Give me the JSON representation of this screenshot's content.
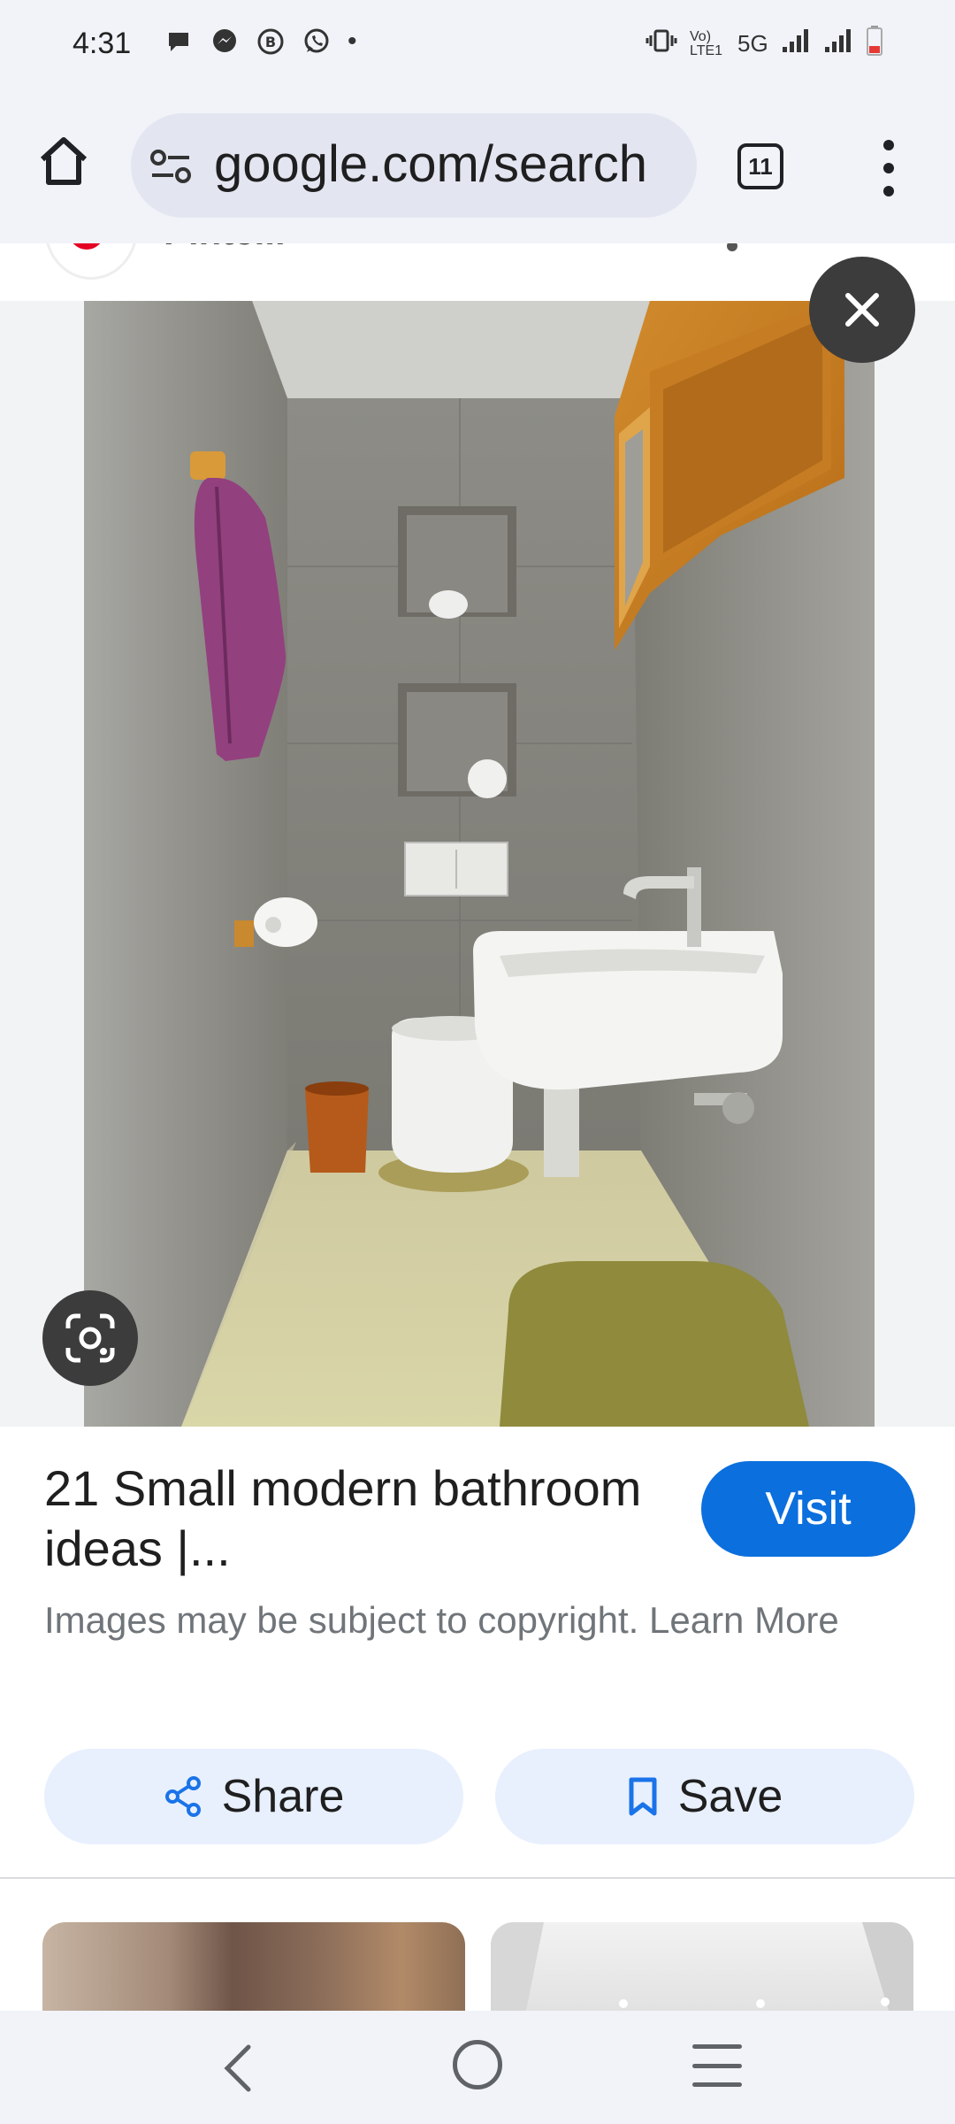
{
  "status_bar": {
    "time": "4:31",
    "network": "5G",
    "volte": "Vo) LTE1",
    "dot": "•",
    "notification_icons": [
      "chat-bubble-icon",
      "messenger-icon",
      "b-app-icon",
      "whatsapp-icon"
    ],
    "right_icons": [
      "vibrate-icon",
      "volte-icon",
      "signal-icon",
      "signal-icon",
      "battery-low-icon"
    ],
    "battery_color": "#e53935"
  },
  "browser": {
    "url": "google.com/search",
    "tab_count": "11"
  },
  "pin_header": {
    "source_name": "Pinte..."
  },
  "result": {
    "title": "21 Small modern bathroom ideas |...",
    "visit_label": "Visit",
    "copyright": "Images may be subject to copyright. Learn More",
    "share_label": "Share",
    "save_label": "Save"
  },
  "colors": {
    "accent": "#0b6fde",
    "button_bg": "#e8f0fe",
    "chrome_bg": "#f1f3f9"
  }
}
